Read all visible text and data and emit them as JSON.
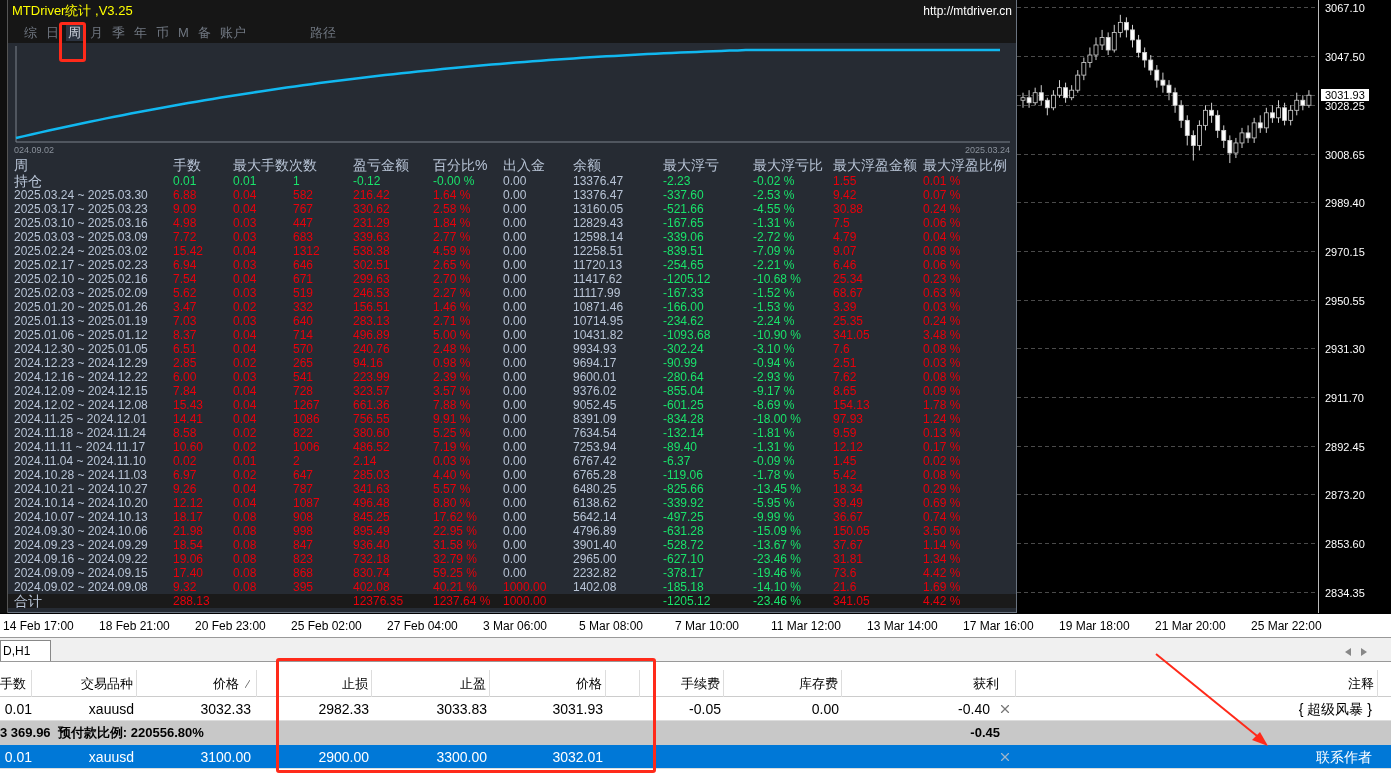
{
  "app_title": "MTDriver统计 ,V3.25",
  "website": "http://mtdriver.cn",
  "tabs": [
    {
      "label": "综",
      "selected": false
    },
    {
      "label": "日",
      "selected": false
    },
    {
      "label": "周",
      "selected": true
    },
    {
      "label": "月",
      "selected": false
    },
    {
      "label": "季",
      "selected": false
    },
    {
      "label": "年",
      "selected": false
    },
    {
      "label": "币",
      "selected": false
    },
    {
      "label": "M",
      "selected": false
    },
    {
      "label": "备",
      "selected": false
    },
    {
      "label": "账户",
      "selected": false
    },
    {
      "label": "路径",
      "selected": false
    }
  ],
  "equity_chart": {
    "start_label": "024.09.02",
    "end_label": "2025.03.24"
  },
  "stats_table": {
    "columns": [
      "周",
      "手数",
      "最大手数次数",
      "",
      "盈亏金额",
      "百分比%",
      "出入金",
      "余额",
      "最大浮亏",
      "最大浮亏比",
      "最大浮盈金额",
      "最大浮盈比例"
    ],
    "rows": [
      {
        "kind": "position",
        "deposit": false,
        "cells": [
          "持仓",
          "0.01",
          "0.01",
          "1",
          "-0.12",
          "-0.00 %",
          "0.00",
          "13376.47",
          "-2.23",
          "-0.02 %",
          "1.55",
          "0.01 %"
        ]
      },
      {
        "kind": "week",
        "deposit": false,
        "cells": [
          "2025.03.24 ~ 2025.03.30",
          "6.88",
          "0.04",
          "582",
          "216.42",
          "1.64 %",
          "0.00",
          "13376.47",
          "-337.60",
          "-2.53 %",
          "9.42",
          "0.07 %"
        ]
      },
      {
        "kind": "week",
        "deposit": false,
        "cells": [
          "2025.03.17 ~ 2025.03.23",
          "9.09",
          "0.04",
          "767",
          "330.62",
          "2.58 %",
          "0.00",
          "13160.05",
          "-521.66",
          "-4.55 %",
          "30.88",
          "0.24 %"
        ]
      },
      {
        "kind": "week",
        "deposit": false,
        "cells": [
          "2025.03.10 ~ 2025.03.16",
          "4.98",
          "0.03",
          "447",
          "231.29",
          "1.84 %",
          "0.00",
          "12829.43",
          "-167.65",
          "-1.31 %",
          "7.5",
          "0.06 %"
        ]
      },
      {
        "kind": "week",
        "deposit": false,
        "cells": [
          "2025.03.03 ~ 2025.03.09",
          "7.72",
          "0.03",
          "683",
          "339.63",
          "2.77 %",
          "0.00",
          "12598.14",
          "-339.06",
          "-2.72 %",
          "4.79",
          "0.04 %"
        ]
      },
      {
        "kind": "week",
        "deposit": false,
        "cells": [
          "2025.02.24 ~ 2025.03.02",
          "15.42",
          "0.04",
          "1312",
          "538.38",
          "4.59 %",
          "0.00",
          "12258.51",
          "-839.51",
          "-7.09 %",
          "9.07",
          "0.08 %"
        ]
      },
      {
        "kind": "week",
        "deposit": false,
        "cells": [
          "2025.02.17 ~ 2025.02.23",
          "6.94",
          "0.03",
          "646",
          "302.51",
          "2.65 %",
          "0.00",
          "11720.13",
          "-254.65",
          "-2.21 %",
          "6.46",
          "0.06 %"
        ]
      },
      {
        "kind": "week",
        "deposit": false,
        "cells": [
          "2025.02.10 ~ 2025.02.16",
          "7.54",
          "0.04",
          "671",
          "299.63",
          "2.70 %",
          "0.00",
          "11417.62",
          "-1205.12",
          "-10.68 %",
          "25.34",
          "0.23 %"
        ]
      },
      {
        "kind": "week",
        "deposit": false,
        "cells": [
          "2025.02.03 ~ 2025.02.09",
          "5.62",
          "0.03",
          "519",
          "246.53",
          "2.27 %",
          "0.00",
          "11117.99",
          "-167.33",
          "-1.52 %",
          "68.67",
          "0.63 %"
        ]
      },
      {
        "kind": "week",
        "deposit": false,
        "cells": [
          "2025.01.20 ~ 2025.01.26",
          "3.47",
          "0.02",
          "332",
          "156.51",
          "1.46 %",
          "0.00",
          "10871.46",
          "-166.00",
          "-1.53 %",
          "3.39",
          "0.03 %"
        ]
      },
      {
        "kind": "week",
        "deposit": false,
        "cells": [
          "2025.01.13 ~ 2025.01.19",
          "7.03",
          "0.03",
          "640",
          "283.13",
          "2.71 %",
          "0.00",
          "10714.95",
          "-234.62",
          "-2.24 %",
          "25.35",
          "0.24 %"
        ]
      },
      {
        "kind": "week",
        "deposit": false,
        "cells": [
          "2025.01.06 ~ 2025.01.12",
          "8.37",
          "0.04",
          "714",
          "496.89",
          "5.00 %",
          "0.00",
          "10431.82",
          "-1093.68",
          "-10.90 %",
          "341.05",
          "3.48 %"
        ]
      },
      {
        "kind": "week",
        "deposit": false,
        "cells": [
          "2024.12.30 ~ 2025.01.05",
          "6.51",
          "0.04",
          "570",
          "240.76",
          "2.48 %",
          "0.00",
          "9934.93",
          "-302.24",
          "-3.10 %",
          "7.6",
          "0.08 %"
        ]
      },
      {
        "kind": "week",
        "deposit": false,
        "cells": [
          "2024.12.23 ~ 2024.12.29",
          "2.85",
          "0.02",
          "265",
          "94.16",
          "0.98 %",
          "0.00",
          "9694.17",
          "-90.99",
          "-0.94 %",
          "2.51",
          "0.03 %"
        ]
      },
      {
        "kind": "week",
        "deposit": false,
        "cells": [
          "2024.12.16 ~ 2024.12.22",
          "6.00",
          "0.03",
          "541",
          "223.99",
          "2.39 %",
          "0.00",
          "9600.01",
          "-280.64",
          "-2.93 %",
          "7.62",
          "0.08 %"
        ]
      },
      {
        "kind": "week",
        "deposit": false,
        "cells": [
          "2024.12.09 ~ 2024.12.15",
          "7.84",
          "0.04",
          "728",
          "323.57",
          "3.57 %",
          "0.00",
          "9376.02",
          "-855.04",
          "-9.17 %",
          "8.65",
          "0.09 %"
        ]
      },
      {
        "kind": "week",
        "deposit": false,
        "cells": [
          "2024.12.02 ~ 2024.12.08",
          "15.43",
          "0.04",
          "1267",
          "661.36",
          "7.88 %",
          "0.00",
          "9052.45",
          "-601.25",
          "-8.69 %",
          "154.13",
          "1.78 %"
        ]
      },
      {
        "kind": "week",
        "deposit": false,
        "cells": [
          "2024.11.25 ~ 2024.12.01",
          "14.41",
          "0.04",
          "1086",
          "756.55",
          "9.91 %",
          "0.00",
          "8391.09",
          "-834.28",
          "-18.00 %",
          "97.93",
          "1.24 %"
        ]
      },
      {
        "kind": "week",
        "deposit": false,
        "cells": [
          "2024.11.18 ~ 2024.11.24",
          "8.58",
          "0.02",
          "822",
          "380.60",
          "5.25 %",
          "0.00",
          "7634.54",
          "-132.14",
          "-1.81 %",
          "9.59",
          "0.13 %"
        ]
      },
      {
        "kind": "week",
        "deposit": false,
        "cells": [
          "2024.11.11 ~ 2024.11.17",
          "10.60",
          "0.02",
          "1006",
          "486.52",
          "7.19 %",
          "0.00",
          "7253.94",
          "-89.40",
          "-1.31 %",
          "12.12",
          "0.17 %"
        ]
      },
      {
        "kind": "week",
        "deposit": false,
        "cells": [
          "2024.11.04 ~ 2024.11.10",
          "0.02",
          "0.01",
          "2",
          "2.14",
          "0.03 %",
          "0.00",
          "6767.42",
          "-6.37",
          "-0.09 %",
          "1.45",
          "0.02 %"
        ]
      },
      {
        "kind": "week",
        "deposit": false,
        "cells": [
          "2024.10.28 ~ 2024.11.03",
          "6.97",
          "0.02",
          "647",
          "285.03",
          "4.40 %",
          "0.00",
          "6765.28",
          "-119.06",
          "-1.78 %",
          "5.42",
          "0.08 %"
        ]
      },
      {
        "kind": "week",
        "deposit": false,
        "cells": [
          "2024.10.21 ~ 2024.10.27",
          "9.26",
          "0.04",
          "787",
          "341.63",
          "5.57 %",
          "0.00",
          "6480.25",
          "-825.66",
          "-13.45 %",
          "18.34",
          "0.29 %"
        ]
      },
      {
        "kind": "week",
        "deposit": false,
        "cells": [
          "2024.10.14 ~ 2024.10.20",
          "12.12",
          "0.04",
          "1087",
          "496.48",
          "8.80 %",
          "0.00",
          "6138.62",
          "-339.92",
          "-5.95 %",
          "39.49",
          "0.69 %"
        ]
      },
      {
        "kind": "week",
        "deposit": false,
        "cells": [
          "2024.10.07 ~ 2024.10.13",
          "18.17",
          "0.08",
          "908",
          "845.25",
          "17.62 %",
          "0.00",
          "5642.14",
          "-497.25",
          "-9.99 %",
          "36.67",
          "0.74 %"
        ]
      },
      {
        "kind": "week",
        "deposit": false,
        "cells": [
          "2024.09.30 ~ 2024.10.06",
          "21.98",
          "0.08",
          "998",
          "895.49",
          "22.95 %",
          "0.00",
          "4796.89",
          "-631.28",
          "-15.09 %",
          "150.05",
          "3.50 %"
        ]
      },
      {
        "kind": "week",
        "deposit": false,
        "cells": [
          "2024.09.23 ~ 2024.09.29",
          "18.54",
          "0.08",
          "847",
          "936.40",
          "31.58 %",
          "0.00",
          "3901.40",
          "-528.72",
          "-13.67 %",
          "37.67",
          "1.14 %"
        ]
      },
      {
        "kind": "week",
        "deposit": false,
        "cells": [
          "2024.09.16 ~ 2024.09.22",
          "19.06",
          "0.08",
          "823",
          "732.18",
          "32.79 %",
          "0.00",
          "2965.00",
          "-627.10",
          "-23.46 %",
          "31.81",
          "1.34 %"
        ]
      },
      {
        "kind": "week",
        "deposit": false,
        "cells": [
          "2024.09.09 ~ 2024.09.15",
          "17.40",
          "0.08",
          "868",
          "830.74",
          "59.25 %",
          "0.00",
          "2232.82",
          "-378.17",
          "-19.46 %",
          "73.6",
          "4.42 %"
        ]
      },
      {
        "kind": "week",
        "deposit": true,
        "cells": [
          "2024.09.02 ~ 2024.09.08",
          "9.32",
          "0.08",
          "395",
          "402.08",
          "40.21 %",
          "1000.00",
          "1402.08",
          "-185.18",
          "-14.10 %",
          "21.6",
          "1.69 %"
        ]
      },
      {
        "kind": "total",
        "deposit": true,
        "cells": [
          "合计",
          "288.13",
          null,
          null,
          "12376.35",
          "1237.64 %",
          "1000.00",
          null,
          "-1205.12",
          "-23.46 %",
          "341.05",
          "4.42 %"
        ]
      }
    ]
  },
  "price_chart": {
    "current_price": "3031.93",
    "chart_data": {
      "type": "candlestick",
      "grid": true,
      "ylim": [
        2825.9,
        3069.9
      ],
      "yticks": [
        {
          "value": 3067.1,
          "label": "3067.10"
        },
        {
          "value": 3047.5,
          "label": "3047.50"
        },
        {
          "value": 3028.25,
          "label": "3028.25"
        },
        {
          "value": 3008.65,
          "label": "3008.65"
        },
        {
          "value": 2989.4,
          "label": "2989.40"
        },
        {
          "value": 2970.15,
          "label": "2970.15"
        },
        {
          "value": 2950.55,
          "label": "2950.55"
        },
        {
          "value": 2931.3,
          "label": "2931.30"
        },
        {
          "value": 2911.7,
          "label": "2911.70"
        },
        {
          "value": 2892.45,
          "label": "2892.45"
        },
        {
          "value": 2873.2,
          "label": "2873.20"
        },
        {
          "value": 2853.6,
          "label": "2853.60"
        },
        {
          "value": 2834.35,
          "label": "2834.35"
        }
      ],
      "ohlc": [
        [
          3030,
          3033,
          3027,
          3031
        ],
        [
          3031,
          3034,
          3027,
          3029
        ],
        [
          3029,
          3035,
          3028,
          3033
        ],
        [
          3033,
          3036,
          3028,
          3030
        ],
        [
          3030,
          3031,
          3024,
          3027
        ],
        [
          3027,
          3034,
          3026,
          3032
        ],
        [
          3032,
          3038,
          3031,
          3035
        ],
        [
          3035,
          3037,
          3029,
          3031
        ],
        [
          3031,
          3036,
          3030,
          3034
        ],
        [
          3034,
          3042,
          3033,
          3040
        ],
        [
          3040,
          3047,
          3038,
          3045
        ],
        [
          3045,
          3051,
          3043,
          3048
        ],
        [
          3048,
          3055,
          3046,
          3052
        ],
        [
          3052,
          3058,
          3050,
          3055
        ],
        [
          3055,
          3057,
          3048,
          3050
        ],
        [
          3050,
          3060,
          3049,
          3057
        ],
        [
          3057,
          3064,
          3055,
          3061
        ],
        [
          3061,
          3063,
          3055,
          3058
        ],
        [
          3058,
          3060,
          3051,
          3054
        ],
        [
          3054,
          3056,
          3047,
          3049
        ],
        [
          3049,
          3051,
          3043,
          3046
        ],
        [
          3046,
          3048,
          3040,
          3042
        ],
        [
          3042,
          3044,
          3035,
          3038
        ],
        [
          3038,
          3041,
          3033,
          3036
        ],
        [
          3036,
          3038,
          3030,
          3033
        ],
        [
          3033,
          3035,
          3025,
          3028
        ],
        [
          3028,
          3030,
          3019,
          3022
        ],
        [
          3022,
          3024,
          3012,
          3016
        ],
        [
          3016,
          3018,
          3006,
          3012
        ],
        [
          3012,
          3022,
          3010,
          3020
        ],
        [
          3020,
          3028,
          3018,
          3026
        ],
        [
          3026,
          3029,
          3021,
          3024
        ],
        [
          3024,
          3026,
          3015,
          3018
        ],
        [
          3018,
          3020,
          3011,
          3014
        ],
        [
          3014,
          3016,
          3005,
          3009
        ],
        [
          3009,
          3015,
          3007,
          3013
        ],
        [
          3013,
          3019,
          3011,
          3017
        ],
        [
          3017,
          3020,
          3013,
          3015
        ],
        [
          3015,
          3023,
          3013,
          3021
        ],
        [
          3021,
          3024,
          3017,
          3019
        ],
        [
          3019,
          3027,
          3017,
          3025
        ],
        [
          3025,
          3028,
          3021,
          3023
        ],
        [
          3023,
          3030,
          3021,
          3027
        ],
        [
          3027,
          3029,
          3020,
          3022
        ],
        [
          3022,
          3028,
          3020,
          3026
        ],
        [
          3026,
          3033,
          3024,
          3030
        ],
        [
          3030,
          3032,
          3026,
          3028
        ],
        [
          3028,
          3034,
          3027,
          3032
        ]
      ]
    }
  },
  "time_axis": [
    "14 Feb 17:00",
    "18 Feb 21:00",
    "20 Feb 23:00",
    "25 Feb 02:00",
    "27 Feb 04:00",
    "3 Mar 06:00",
    "5 Mar 08:00",
    "7 Mar 10:00",
    "11 Mar 12:00",
    "13 Mar 14:00",
    "17 Mar 16:00",
    "19 Mar 18:00",
    "21 Mar 20:00",
    "25 Mar 22:00"
  ],
  "chart_tab": "D,H1",
  "trade_table": {
    "columns": [
      "手数",
      "交易品种",
      "价格",
      "止损",
      "止盈",
      "价格",
      "手续费",
      "库存费",
      "获利",
      "注释"
    ],
    "rows": [
      {
        "kind": "order",
        "selected": false,
        "cells": [
          "0.01",
          "xauusd",
          "3032.33",
          "2982.33",
          "3033.83",
          "3031.93",
          "-0.05",
          "0.00",
          "-0.40",
          "{ 超级风暴 }"
        ]
      },
      {
        "kind": "summary",
        "selected": false,
        "text": "3 369.96  预付款比例: 220556.80%",
        "profit": "-0.45"
      },
      {
        "kind": "order",
        "selected": true,
        "cells": [
          "0.01",
          "xauusd",
          "3100.00",
          "2900.00",
          "3300.00",
          "3032.01",
          null,
          null,
          null,
          "联系作者"
        ]
      }
    ]
  }
}
